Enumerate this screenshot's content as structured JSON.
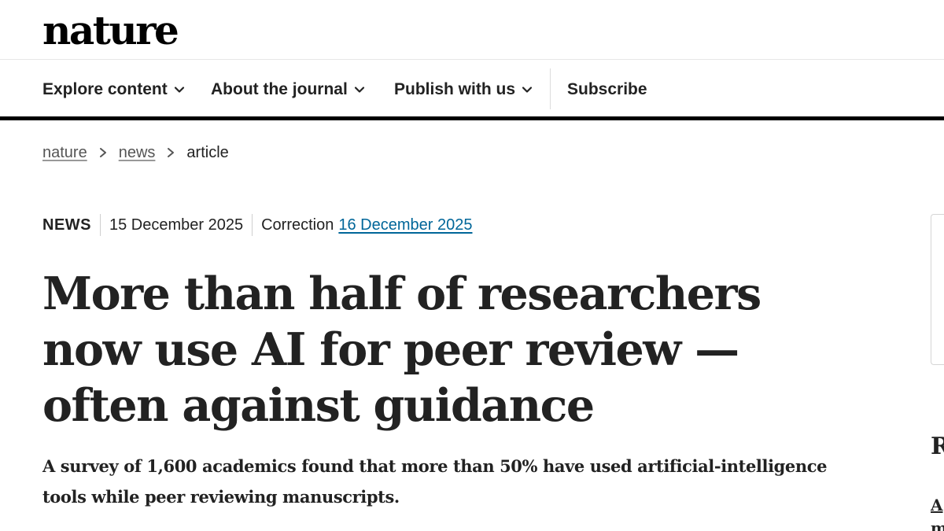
{
  "site": {
    "logo": "nature"
  },
  "nav": {
    "items": [
      {
        "label": "Explore content",
        "has_dropdown": true
      },
      {
        "label": "About the journal",
        "has_dropdown": true
      },
      {
        "label": "Publish with us",
        "has_dropdown": true
      }
    ],
    "subscribe_label": "Subscribe"
  },
  "breadcrumb": {
    "items": [
      {
        "label": "nature",
        "link": true
      },
      {
        "label": "news",
        "link": true
      },
      {
        "label": "article",
        "link": false
      }
    ]
  },
  "article": {
    "type": "NEWS",
    "date": "15 December 2025",
    "correction_label": "Correction",
    "correction_date": "16 December 2025",
    "title": "More than half of researchers now use AI for peer review — often against guidance",
    "standfirst": "A survey of 1,600 academics found that more than 50% have used artificial-intelligence tools while peer reviewing manuscripts."
  },
  "sidebar": {
    "heading_fragment": "R",
    "line1_fragment": "A",
    "line2_fragment": "m"
  },
  "colors": {
    "link": "#006699",
    "text": "#222222",
    "nav_bottom_rule": "#000000"
  }
}
